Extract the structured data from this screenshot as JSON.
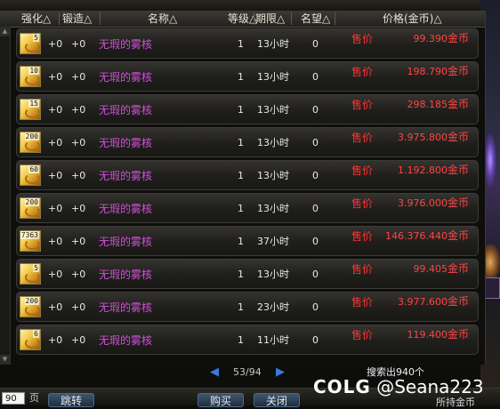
{
  "header": {
    "columns": [
      "强化△",
      "锻造△",
      "名称△",
      "等级△",
      "期限△",
      "名望△",
      "价格(金币)△"
    ]
  },
  "items": [
    {
      "qty": "5",
      "enhance": "+0",
      "forge": "+0",
      "name": "无瑕的雾核",
      "level": "1",
      "duration": "13小时",
      "fame": "0",
      "sell": "售价",
      "price": "99.390",
      "unit": "金币"
    },
    {
      "qty": "10",
      "enhance": "+0",
      "forge": "+0",
      "name": "无瑕的雾核",
      "level": "1",
      "duration": "13小时",
      "fame": "0",
      "sell": "售价",
      "price": "198.790",
      "unit": "金币"
    },
    {
      "qty": "15",
      "enhance": "+0",
      "forge": "+0",
      "name": "无瑕的雾核",
      "level": "1",
      "duration": "13小时",
      "fame": "0",
      "sell": "售价",
      "price": "298.185",
      "unit": "金币"
    },
    {
      "qty": "200",
      "enhance": "+0",
      "forge": "+0",
      "name": "无瑕的雾核",
      "level": "1",
      "duration": "13小时",
      "fame": "0",
      "sell": "售价",
      "price": "3.975.800",
      "unit": "金币"
    },
    {
      "qty": "60",
      "enhance": "+0",
      "forge": "+0",
      "name": "无瑕的雾核",
      "level": "1",
      "duration": "13小时",
      "fame": "0",
      "sell": "售价",
      "price": "1.192.800",
      "unit": "金币"
    },
    {
      "qty": "200",
      "enhance": "+0",
      "forge": "+0",
      "name": "无瑕的雾核",
      "level": "1",
      "duration": "13小时",
      "fame": "0",
      "sell": "售价",
      "price": "3.976.000",
      "unit": "金币"
    },
    {
      "qty": "7363",
      "enhance": "+0",
      "forge": "+0",
      "name": "无瑕的雾核",
      "level": "1",
      "duration": "37小时",
      "fame": "0",
      "sell": "售价",
      "price": "146.376.440",
      "unit": "金币"
    },
    {
      "qty": "5",
      "enhance": "+0",
      "forge": "+0",
      "name": "无瑕的雾核",
      "level": "1",
      "duration": "13小时",
      "fame": "0",
      "sell": "售价",
      "price": "99.405",
      "unit": "金币"
    },
    {
      "qty": "200",
      "enhance": "+0",
      "forge": "+0",
      "name": "无瑕的雾核",
      "level": "1",
      "duration": "23小时",
      "fame": "0",
      "sell": "售价",
      "price": "3.977.600",
      "unit": "金币"
    },
    {
      "qty": "6",
      "enhance": "+0",
      "forge": "+0",
      "name": "无瑕的雾核",
      "level": "1",
      "duration": "11小时",
      "fame": "0",
      "sell": "售价",
      "price": "119.400",
      "unit": "金币"
    }
  ],
  "pager": {
    "prev_icon": "triangle-left-icon",
    "next_icon": "triangle-right-icon",
    "text": "53/94"
  },
  "search_result": "搜索出940个",
  "bottom": {
    "page_input": "90",
    "page_label": "页",
    "jump_button": "跳转",
    "buy_button": "购买",
    "close_button": "关闭",
    "gold_label": "所持金币"
  },
  "watermark": {
    "logo": "COLG",
    "handle": "@Seana223"
  },
  "colors": {
    "name": "#d050d8",
    "price": "#ff4545",
    "sell": "#ff3030",
    "pager_arrow": "#3a7ae0"
  }
}
